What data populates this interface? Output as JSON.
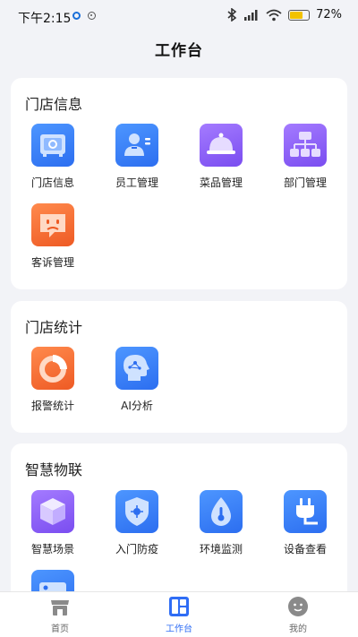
{
  "status_bar": {
    "time": "下午2:15",
    "battery": "72",
    "battery_unit": "%",
    "battery_level": 0.72,
    "icons": [
      "bluetooth-icon",
      "signal-icon",
      "wifi-icon",
      "battery-icon"
    ]
  },
  "page_title": "工作台",
  "sections": [
    {
      "title": "门店信息",
      "items": [
        {
          "label": "门店信息",
          "icon": "store-safe-icon",
          "color": "#2f7df6"
        },
        {
          "label": "员工管理",
          "icon": "staff-badge-icon",
          "color": "#2f7df6"
        },
        {
          "label": "菜品管理",
          "icon": "food-cloche-icon",
          "color": "#8a5cf6"
        },
        {
          "label": "部门管理",
          "icon": "org-chart-icon",
          "color": "#8a5cf6"
        },
        {
          "label": "客诉管理",
          "icon": "complaint-chat-icon",
          "color": "#f26b2f"
        }
      ]
    },
    {
      "title": "门店统计",
      "items": [
        {
          "label": "报警统计",
          "icon": "alarm-pie-icon",
          "color": "#f26b2f"
        },
        {
          "label": "AI分析",
          "icon": "ai-head-icon",
          "color": "#2f7df6"
        }
      ]
    },
    {
      "title": "智慧物联",
      "items": [
        {
          "label": "智慧场景",
          "icon": "scene-cube-icon",
          "color": "#8a5cf6"
        },
        {
          "label": "入门防疫",
          "icon": "shield-virus-icon",
          "color": "#2f7df6"
        },
        {
          "label": "环境监测",
          "icon": "thermometer-drop-icon",
          "color": "#2f7df6"
        },
        {
          "label": "设备查看",
          "icon": "plug-icon",
          "color": "#2f7df6"
        }
      ]
    }
  ],
  "tabs": [
    {
      "label": "首页",
      "icon": "store-front-icon",
      "active": false
    },
    {
      "label": "工作台",
      "icon": "workbench-grid-icon",
      "active": true
    },
    {
      "label": "我的",
      "icon": "smiley-face-icon",
      "active": false
    }
  ],
  "colors": {
    "accent": "#2f6df5",
    "background": "#f2f3f7"
  }
}
